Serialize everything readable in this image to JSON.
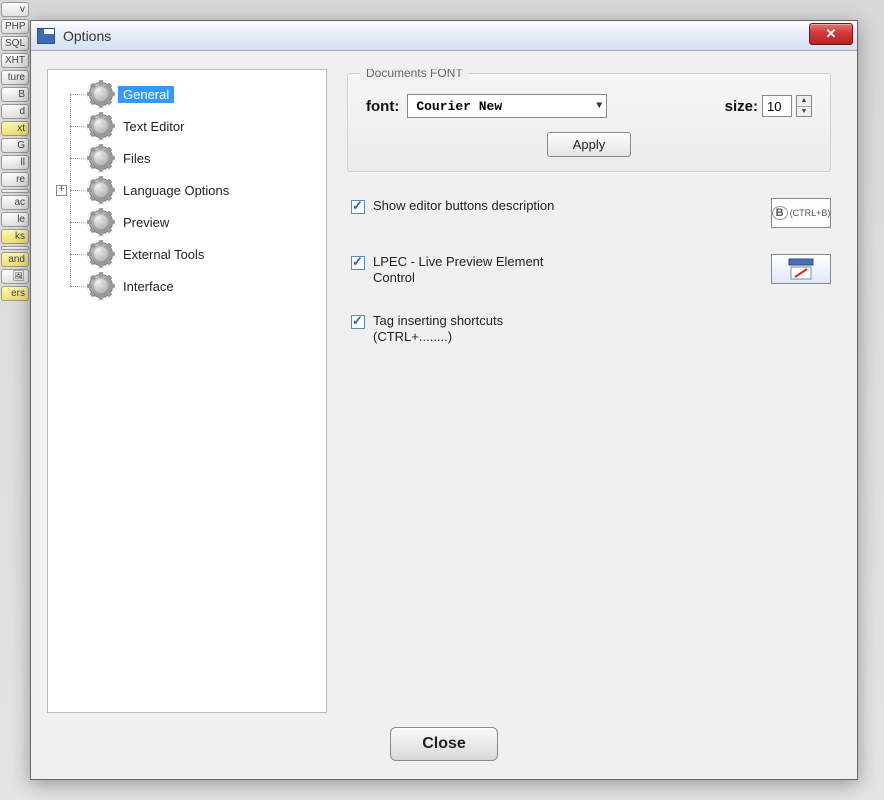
{
  "dialog": {
    "title": "Options",
    "close_button_label": "Close"
  },
  "tree": {
    "items": [
      {
        "label": "General",
        "selected": true,
        "expandable": false
      },
      {
        "label": "Text Editor",
        "selected": false,
        "expandable": false
      },
      {
        "label": "Files",
        "selected": false,
        "expandable": false
      },
      {
        "label": "Language Options",
        "selected": false,
        "expandable": true
      },
      {
        "label": "Preview",
        "selected": false,
        "expandable": false
      },
      {
        "label": "External Tools",
        "selected": false,
        "expandable": false
      },
      {
        "label": "Interface",
        "selected": false,
        "expandable": false
      }
    ]
  },
  "font_group": {
    "legend": "Documents FONT",
    "font_label": "font:",
    "font_value": "Courier New",
    "size_label": "size:",
    "size_value": "10",
    "apply_label": "Apply"
  },
  "checkboxes": [
    {
      "label": "Show editor buttons description",
      "checked": true,
      "badge": "tooltip"
    },
    {
      "label": "LPEC - Live Preview Element Control",
      "checked": true,
      "badge": "lpec"
    },
    {
      "label": "Tag inserting shortcuts (CTRL+........)",
      "checked": true,
      "badge": null
    }
  ],
  "badge_text": {
    "tooltip_hint": "(CTRL+B)"
  }
}
